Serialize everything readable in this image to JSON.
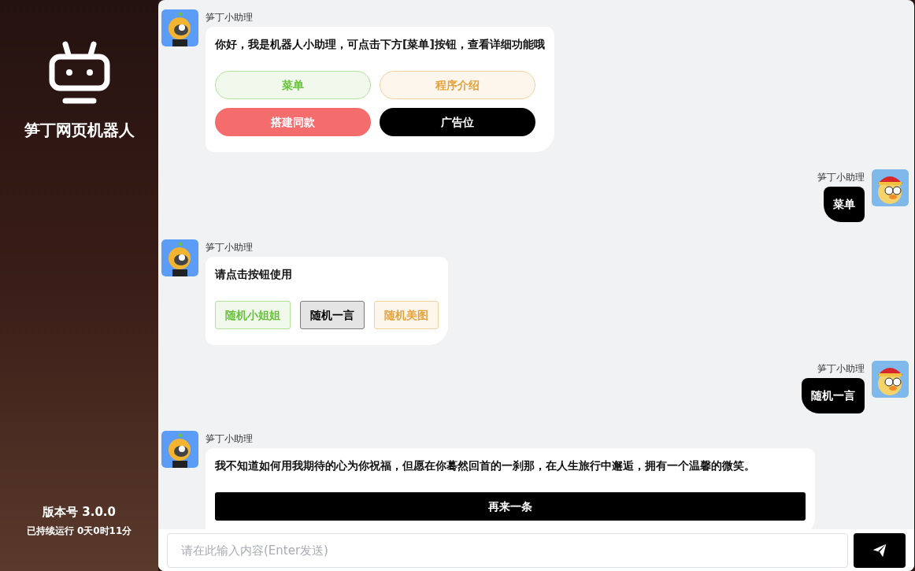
{
  "sidebar": {
    "title": "笋丁网页机器人",
    "version": "版本号 3.0.0",
    "uptime": "已持续运行 0天0时11分"
  },
  "messages": [
    {
      "kind": "pills",
      "sender": "笋丁小助理",
      "text": "你好，我是机器人小助理，可点击下方[菜单]按钮，查看详细功能哦",
      "buttons": [
        {
          "label": "菜单",
          "kind": "green"
        },
        {
          "label": "程序介绍",
          "kind": "orange"
        },
        {
          "label": "搭建同款",
          "kind": "red"
        },
        {
          "label": "广告位",
          "kind": "black"
        }
      ]
    },
    {
      "kind": "user",
      "sender": "笋丁小助理",
      "text": "菜单"
    },
    {
      "kind": "squares",
      "sender": "笋丁小助理",
      "text": "请点击按钮使用",
      "buttons": [
        {
          "label": "随机小姐姐",
          "kind": "green"
        },
        {
          "label": "随机一言",
          "kind": "gray"
        },
        {
          "label": "随机美图",
          "kind": "orange"
        }
      ]
    },
    {
      "kind": "user",
      "sender": "笋丁小助理",
      "text": "随机一言"
    },
    {
      "kind": "wide",
      "sender": "笋丁小助理",
      "text": "我不知道如何用我期待的心为你祝福，但愿在你蓦然回首的一刹那，在人生旅行中邂逅，拥有一个温馨的微笑。",
      "buttons": [
        {
          "label": "再来一条",
          "kind": "black"
        }
      ]
    }
  ],
  "composer": {
    "placeholder": "请在此输入内容(Enter发送)"
  }
}
